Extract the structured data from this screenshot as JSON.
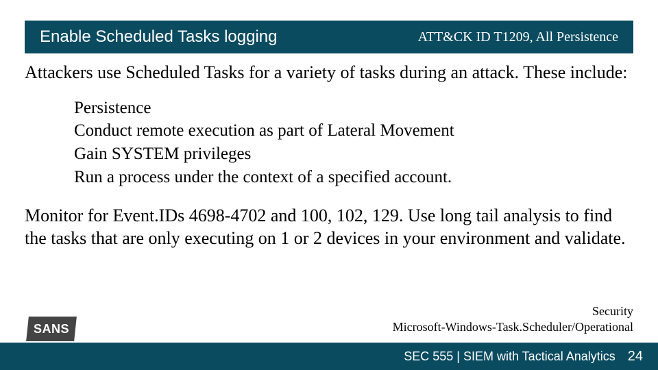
{
  "header": {
    "title": "Enable Scheduled Tasks logging",
    "tag": "ATT&CK ID T1209, All Persistence"
  },
  "intro": "Attackers use Scheduled Tasks for a variety of tasks during an attack. These include:",
  "bullets": [
    "Persistence",
    "Conduct remote execution as part of Lateral Movement",
    "Gain SYSTEM privileges",
    "Run a process under the context of a specified account."
  ],
  "monitor": "Monitor for Event.IDs 4698-4702 and 100, 102, 129.  Use long tail analysis to find the tasks that are only executing on 1 or 2 devices in your environment and validate.",
  "sidenote": {
    "line1": "Security",
    "line2": "Microsoft-Windows-Task.Scheduler/Operational"
  },
  "footer": {
    "course": "SEC 555 | SIEM with Tactical Analytics",
    "page": "24"
  },
  "logo": "SANS"
}
